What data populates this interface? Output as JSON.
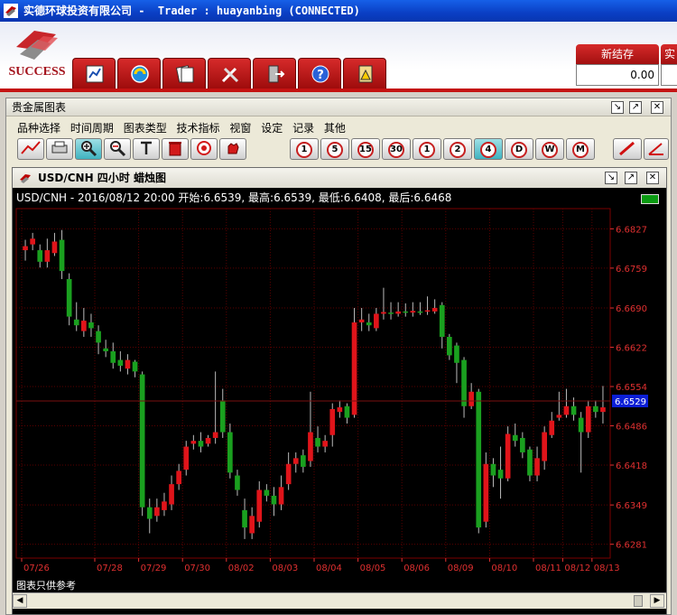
{
  "window": {
    "title": "实德环球投资有限公司 -  Trader : huayanbing (CONNECTED)"
  },
  "logo": {
    "text": "SUCCESS"
  },
  "price_panel": {
    "label": "新结存",
    "value": "0.00",
    "label2": "实"
  },
  "chart_panel": {
    "title": "贵金属图表",
    "menu": [
      "品种选择",
      "时间周期",
      "图表类型",
      "技术指标",
      "视窗",
      "设定",
      "记录",
      "其他"
    ],
    "toolbar_periods": [
      "1",
      "5",
      "15",
      "30",
      "1",
      "2",
      "4",
      "D",
      "W",
      "M"
    ]
  },
  "chart_window": {
    "title": "USD/CNH 四小时 蜡烛图",
    "info": "USD/CNH - 2016/08/12 20:00 开始:6.6539, 最高:6.6539, 最低:6.6408, 最后:6.6468",
    "footer": "图表只供参考"
  },
  "colors": {
    "up": "#e0141a",
    "down": "#1aa01f",
    "grid": "#5a0000",
    "axis_text": "#e03030",
    "bg": "#000000"
  },
  "chart_data": {
    "type": "candlestick",
    "yticks": [
      6.6827,
      6.6759,
      6.669,
      6.6622,
      6.6554,
      6.6486,
      6.6418,
      6.6349,
      6.6281
    ],
    "ylim": [
      6.6257,
      6.6862
    ],
    "current_price": 6.6529,
    "xticks": [
      "07/26",
      "07/28",
      "07/29",
      "07/30",
      "08/02",
      "08/03",
      "08/04",
      "08/05",
      "08/06",
      "08/09",
      "08/10",
      "08/11",
      "08/12",
      "08/13"
    ],
    "candles": [
      [
        6.679,
        6.6797,
        6.6808,
        6.6772
      ],
      [
        6.68,
        6.681,
        6.682,
        6.679
      ],
      [
        6.679,
        6.677,
        6.68,
        6.676
      ],
      [
        6.677,
        6.679,
        6.681,
        6.676
      ],
      [
        6.6785,
        6.6805,
        6.682,
        6.678
      ],
      [
        6.6808,
        6.6754,
        6.6825,
        6.674
      ],
      [
        6.674,
        6.6675,
        6.675,
        6.666
      ],
      [
        6.667,
        6.666,
        6.67,
        6.665
      ],
      [
        6.665,
        6.6668,
        6.669,
        6.664
      ],
      [
        6.6665,
        6.6655,
        6.668,
        6.664
      ],
      [
        6.665,
        6.663,
        6.666,
        6.661
      ],
      [
        6.662,
        6.6615,
        6.6635,
        6.6605
      ],
      [
        6.6615,
        6.6595,
        6.663,
        6.6585
      ],
      [
        6.66,
        6.659,
        6.6615,
        6.658
      ],
      [
        6.6585,
        6.66,
        6.661,
        6.6575
      ],
      [
        6.6597,
        6.658,
        6.66,
        6.657
      ],
      [
        6.6575,
        6.6345,
        6.658,
        6.633
      ],
      [
        6.6345,
        6.6325,
        6.636,
        6.63
      ],
      [
        6.633,
        6.6345,
        6.636,
        6.632
      ],
      [
        6.634,
        6.6355,
        6.637,
        6.633
      ],
      [
        6.635,
        6.6385,
        6.64,
        6.634
      ],
      [
        6.6385,
        6.6408,
        6.642,
        6.6375
      ],
      [
        6.641,
        6.645,
        6.646,
        6.64
      ],
      [
        6.6455,
        6.646,
        6.647,
        6.6445
      ],
      [
        6.646,
        6.645,
        6.6475,
        6.644
      ],
      [
        6.6455,
        6.6465,
        6.647,
        6.645
      ],
      [
        6.6465,
        6.6475,
        6.658,
        6.6455
      ],
      [
        6.653,
        6.6475,
        6.655,
        6.6465
      ],
      [
        6.6475,
        6.6405,
        6.649,
        6.6395
      ],
      [
        6.64,
        6.6375,
        6.641,
        6.6365
      ],
      [
        6.634,
        6.631,
        6.636,
        6.629
      ],
      [
        6.63,
        6.633,
        6.6345,
        6.629
      ],
      [
        6.632,
        6.6375,
        6.639,
        6.631
      ],
      [
        6.6375,
        6.6365,
        6.6385,
        6.6355
      ],
      [
        6.6365,
        6.635,
        6.638,
        6.633
      ],
      [
        6.635,
        6.638,
        6.64,
        6.634
      ],
      [
        6.6385,
        6.642,
        6.644,
        6.6375
      ],
      [
        6.642,
        6.643,
        6.644,
        6.6405
      ],
      [
        6.6435,
        6.6415,
        6.6445,
        6.6405
      ],
      [
        6.6425,
        6.6475,
        6.6545,
        6.6415
      ],
      [
        6.6465,
        6.645,
        6.6485,
        6.644
      ],
      [
        6.645,
        6.646,
        6.647,
        6.644
      ],
      [
        6.647,
        6.6515,
        6.6525,
        6.645
      ],
      [
        6.651,
        6.6518,
        6.653,
        6.65
      ],
      [
        6.652,
        6.65,
        6.6525,
        6.649
      ],
      [
        6.6505,
        6.6665,
        6.669,
        6.65
      ],
      [
        6.6665,
        6.667,
        6.669,
        6.665
      ],
      [
        6.6665,
        6.666,
        6.668,
        6.665
      ],
      [
        6.6655,
        6.668,
        6.669,
        6.665
      ],
      [
        6.668,
        6.6683,
        6.6725,
        6.667
      ],
      [
        6.6682,
        6.668,
        6.67,
        6.667
      ],
      [
        6.668,
        6.6684,
        6.67,
        6.6675
      ],
      [
        6.6684,
        6.6682,
        6.6698,
        6.6675
      ],
      [
        6.6682,
        6.6685,
        6.67,
        6.6675
      ],
      [
        6.6684,
        6.6683,
        6.67,
        6.6678
      ],
      [
        6.6684,
        6.6686,
        6.671,
        6.6678
      ],
      [
        6.6684,
        6.669,
        6.6705,
        6.668
      ],
      [
        6.6695,
        6.664,
        6.67,
        6.662
      ],
      [
        6.664,
        6.6608,
        6.6645,
        6.66
      ],
      [
        6.6625,
        6.6595,
        6.663,
        6.656
      ],
      [
        6.66,
        6.652,
        6.6605,
        6.65
      ],
      [
        6.652,
        6.6545,
        6.656,
        6.6515
      ],
      [
        6.6545,
        6.631,
        6.655,
        6.63
      ],
      [
        6.632,
        6.642,
        6.644,
        6.631
      ],
      [
        6.642,
        6.64,
        6.643,
        6.638
      ],
      [
        6.641,
        6.6395,
        6.645,
        6.636
      ],
      [
        6.6395,
        6.6472,
        6.6485,
        6.639
      ],
      [
        6.647,
        6.646,
        6.649,
        6.645
      ],
      [
        6.6465,
        6.644,
        6.6475,
        6.643
      ],
      [
        6.6445,
        6.64,
        6.645,
        6.639
      ],
      [
        6.64,
        6.643,
        6.645,
        6.639
      ],
      [
        6.6425,
        6.6475,
        6.6485,
        6.641
      ],
      [
        6.647,
        6.6495,
        6.651,
        6.6465
      ],
      [
        6.65,
        6.6505,
        6.6545,
        6.6495
      ],
      [
        6.6505,
        6.652,
        6.655,
        6.65
      ],
      [
        6.652,
        6.6505,
        6.6535,
        6.6495
      ],
      [
        6.65,
        6.6475,
        6.651,
        6.6405
      ],
      [
        6.6475,
        6.652,
        6.653,
        6.6465
      ],
      [
        6.652,
        6.651,
        6.653,
        6.65
      ],
      [
        6.651,
        6.6518,
        6.6555,
        6.649
      ]
    ]
  }
}
